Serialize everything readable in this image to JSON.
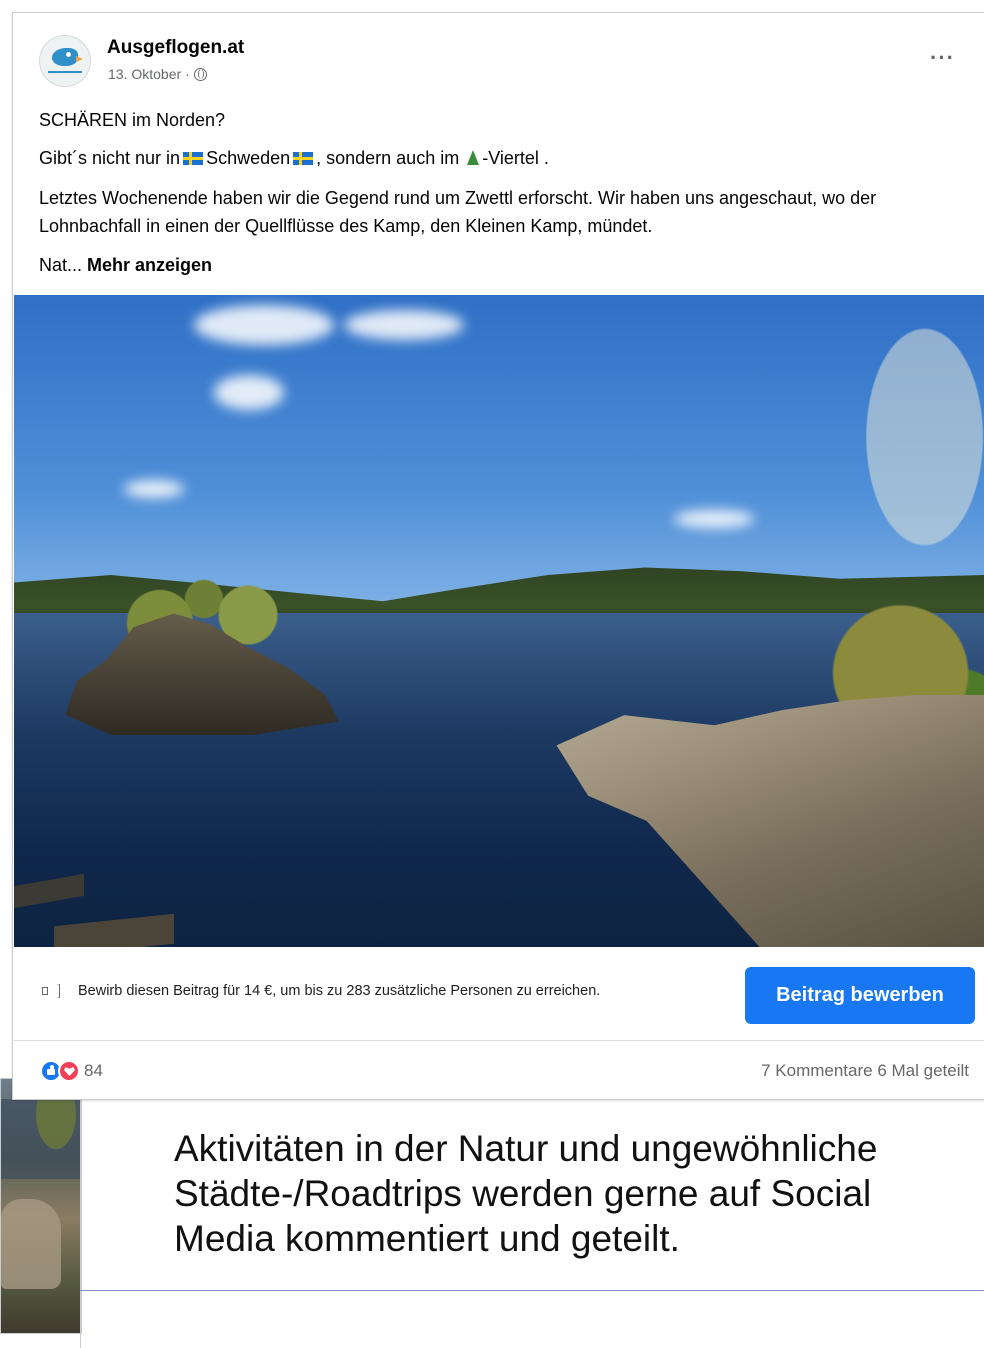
{
  "post": {
    "page_name": "Ausgeflogen.at",
    "date": "13. Oktober",
    "date_separator": "·",
    "more_options": "···",
    "headline": "SCHÄREN im Norden?",
    "line2_part1": "Gibt´s nicht nur in",
    "line2_part2": "Schweden",
    "line2_part3": ", sondern auch im",
    "line2_part4": "-Viertel .",
    "body": "Letztes Wochenende haben wir die Gegend rund um Zwettl erforscht. Wir haben uns angeschaut, wo der Lohnbachfall in einen der Quellflüsse des Kamp, den Kleinen Kamp, mündet.",
    "truncated": "Nat...",
    "see_more": "Mehr anzeigen",
    "photo_alt": "Lake with rocky island and granite shore under blue sky"
  },
  "promote": {
    "text": "Bewirb diesen Beitrag für 14 €, um bis zu 283 zusätzliche Personen zu erreichen.",
    "button": "Beitrag bewerben",
    "icon": "megaphone-icon"
  },
  "reactions": {
    "count": "84",
    "comments": "7 Kommentare",
    "shares": "6 Mal geteilt"
  },
  "caption": "Aktivitäten in der Natur und ungewöhnliche Städte-/Roadtrips werden gerne auf Social Media kommentiert und geteilt.",
  "colors": {
    "primary_button": "#1877f2",
    "secondary_text": "#65676b",
    "like": "#1877f2",
    "love": "#f33e58"
  }
}
